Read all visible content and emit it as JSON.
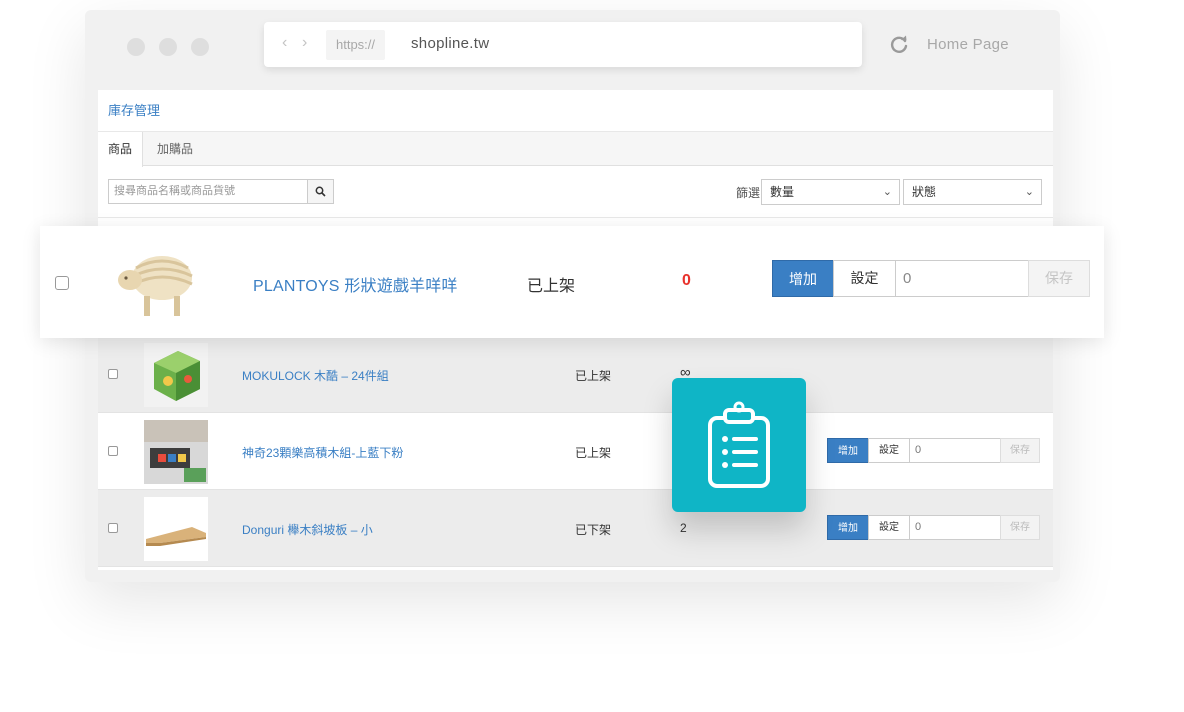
{
  "browser": {
    "scheme": "https://",
    "domain": "shopline.tw",
    "home_label": "Home Page",
    "icons": {
      "back": "chevron-left-icon",
      "forward": "chevron-right-icon",
      "reload": "reload-icon"
    }
  },
  "page": {
    "title": "庫存管理",
    "tabs": [
      {
        "label": "商品",
        "active": true
      },
      {
        "label": "加購品",
        "active": false
      }
    ],
    "search": {
      "placeholder": "搜尋商品名稱或商品貨號"
    },
    "filter": {
      "label": "篩選",
      "quantity_select": "數量",
      "status_select": "狀態"
    }
  },
  "highlight_row": {
    "name": "PLANTOYS 形狀遊戲羊咩咩",
    "status": "已上架",
    "quantity": "0",
    "add_label": "增加",
    "set_label": "設定",
    "input_value": "0",
    "save_label": "保存"
  },
  "rows": [
    {
      "name": "MOKULOCK 木酷 – 24件組",
      "status": "已上架",
      "quantity": "∞"
    },
    {
      "name": "神奇23顆樂高積木組-上藍下粉",
      "status": "已上架",
      "quantity": "",
      "add_label": "增加",
      "set_label": "設定",
      "input_value": "0",
      "save_label": "保存"
    },
    {
      "name": "Donguri 櫸木斜坡板 – 小",
      "status": "已下架",
      "quantity": "2",
      "add_label": "增加",
      "set_label": "設定",
      "input_value": "0",
      "save_label": "保存"
    }
  ],
  "colors": {
    "accent": "#3a7fc4",
    "badge": "#0fb5c6",
    "zero_qty": "#e8322c"
  }
}
